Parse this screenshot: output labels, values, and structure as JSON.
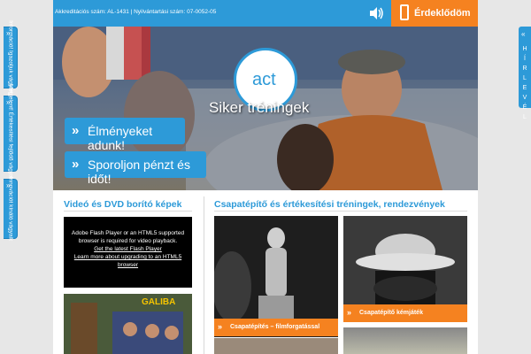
{
  "sidebar_tabs": [
    {
      "label": "Információ! Igazoljuk vágyait."
    },
    {
      "label": "Megjelent! Értékesítési fejlődő vágyaik."
    },
    {
      "label": "Innovációt kínáló vágyaik"
    }
  ],
  "newsletter": {
    "label": "HÍRLEVÉL",
    "letters": [
      "H",
      "Í",
      "R",
      "L",
      "E",
      "V",
      "É",
      "L"
    ]
  },
  "topbar": {
    "accreditation": "Akkreditációs szám: AL-1431 | Nyilvántartási szám: 07-0052-05",
    "interest_button": "Érdeklődöm"
  },
  "logo": {
    "text": "act"
  },
  "hero": {
    "title": "Siker tréningek",
    "buttons": [
      "Élményeket adunk!",
      "Sporoljon pénzt és időt!"
    ]
  },
  "video_section": {
    "heading": "Videó és DVD borító képek",
    "flash_line1": "Adobe Flash Player or an HTML5 supported browser is required for video playback.",
    "flash_link1": "Get the latest Flash Player",
    "flash_link2": "Learn more about upgrading to an HTML5 browser",
    "thumb_logo": "GALIBA"
  },
  "trainings_section": {
    "heading": "Csapatépítő és értékesítési tréningek, rendezvények",
    "items": [
      {
        "label": "Csapatépítés – filmforgatással"
      },
      {
        "label": "Csapatépítő kémjáték"
      }
    ]
  },
  "colors": {
    "accent": "#2d9ad8",
    "orange": "#f58220"
  }
}
